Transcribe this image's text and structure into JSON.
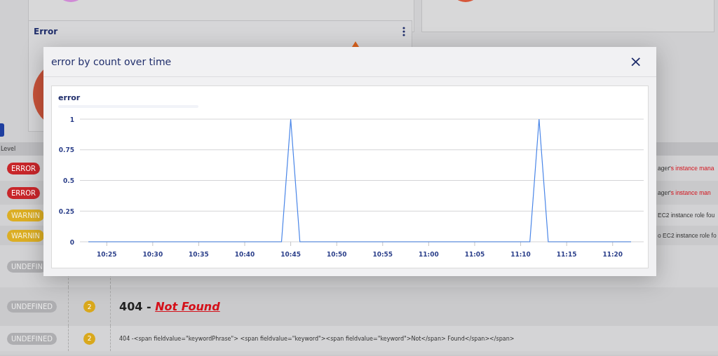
{
  "error_card": {
    "title": "Error"
  },
  "table": {
    "columns": [
      "Level"
    ],
    "rows": [
      {
        "level": "ERROR",
        "kind": "error",
        "message_tail": "ager'",
        "message_highlight": "s instance mana"
      },
      {
        "level": "ERROR",
        "kind": "error",
        "message_tail": "ager'",
        "message_highlight": "s instance man"
      },
      {
        "level": "WARNIN",
        "kind": "warning",
        "message_tail": "EC2 instance role fou"
      },
      {
        "level": "WARNIN",
        "kind": "warning",
        "message_tail": "o EC2 instance role fo"
      },
      {
        "level": "UNDEFIN",
        "kind": "undefined"
      },
      {
        "level": "UNDEFINED",
        "kind": "undefined",
        "count": "2",
        "message": {
          "kind": "heading",
          "text": "404 - ",
          "link": "Not Found"
        }
      },
      {
        "level": "UNDEFINED",
        "kind": "undefined",
        "count": "2",
        "message": {
          "kind": "code",
          "text": "404 -<span fieldvalue=\"keywordPhrase\"> <span fieldvalue=\"keyword\"><span fieldvalue=\"keyword\">Not</span> Found</span></span>"
        }
      }
    ]
  },
  "modal": {
    "title": "error by count over time",
    "close": "×",
    "chart_data": {
      "type": "line",
      "title": "error",
      "categories": [
        null,
        null,
        "10:25",
        null,
        null,
        null,
        null,
        "10:30",
        null,
        null,
        null,
        null,
        "10:35",
        null,
        null,
        null,
        null,
        "10:40",
        null,
        null,
        null,
        null,
        "10:45",
        null,
        null,
        null,
        null,
        "10:50",
        null,
        null,
        null,
        null,
        "10:55",
        null,
        null,
        null,
        null,
        "11:00",
        null,
        null,
        null,
        null,
        "11:05",
        null,
        null,
        null,
        null,
        "11:10",
        null,
        null,
        null,
        null,
        "11:15",
        null,
        null,
        null,
        null,
        "11:20",
        null,
        null
      ],
      "series": [
        {
          "color": "#4a86e8",
          "values": [
            0,
            0,
            0,
            0,
            0,
            0,
            0,
            0,
            0,
            0,
            0,
            0,
            0,
            0,
            0,
            0,
            0,
            0,
            0,
            0,
            0,
            0,
            1,
            0,
            0,
            0,
            0,
            0,
            0,
            0,
            0,
            0,
            0,
            0,
            0,
            0,
            0,
            0,
            0,
            0,
            0,
            0,
            0,
            0,
            0,
            0,
            0,
            0,
            0,
            1,
            0,
            0,
            0,
            0,
            0,
            0,
            0,
            0,
            0,
            0
          ]
        }
      ],
      "ylim": [
        0,
        1
      ],
      "grid": true,
      "yticks": [
        0,
        0.25,
        0.5,
        0.75,
        1
      ]
    }
  }
}
